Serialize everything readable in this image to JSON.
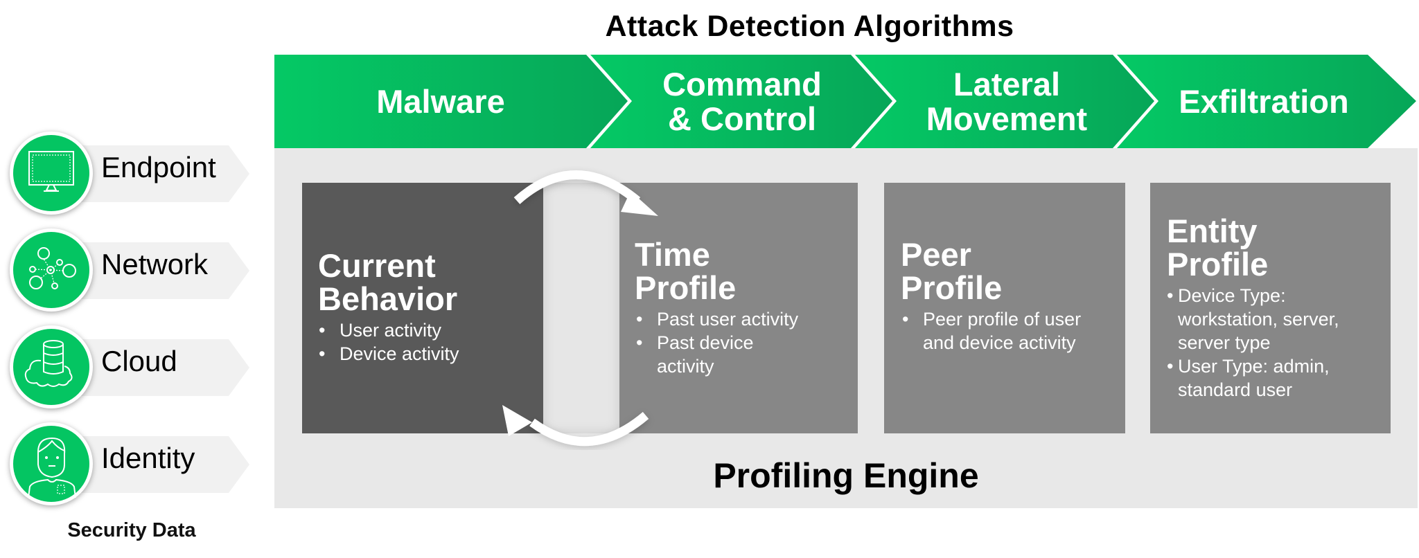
{
  "title": "Attack Detection Algorithms",
  "colors": {
    "green": "#04c562",
    "green_dark": "#05a95a",
    "engine_bg": "#e8e8e8",
    "card_dark": "#595959",
    "card_mid": "#878787",
    "source_band": "#f1f1f1"
  },
  "stages": [
    {
      "label": "Malware"
    },
    {
      "label": "Command\n& Control"
    },
    {
      "label": "Lateral\nMovement"
    },
    {
      "label": "Exfiltration"
    }
  ],
  "sources": {
    "items": [
      {
        "label": "Endpoint",
        "icon": "monitor-icon"
      },
      {
        "label": "Network",
        "icon": "network-nodes-icon"
      },
      {
        "label": "Cloud",
        "icon": "cloud-database-icon"
      },
      {
        "label": "Identity",
        "icon": "person-icon"
      }
    ],
    "caption": "Security Data"
  },
  "engine": {
    "title": "Profiling Engine",
    "cards": [
      {
        "title": "Current\nBehavior",
        "bullets": [
          "User activity",
          "Device activity"
        ]
      },
      {
        "title": "Time\nProfile",
        "bullets": [
          "Past user activity",
          "Past device activity"
        ]
      },
      {
        "title": "Peer\nProfile",
        "bullets": [
          "Peer profile of user and device activity"
        ]
      },
      {
        "title": "Entity\nProfile",
        "bullets": [
          "Device Type: workstation, server, server type",
          "User Type: admin, standard user"
        ]
      }
    ],
    "cycle_icon": "cycle-arrows-icon"
  }
}
